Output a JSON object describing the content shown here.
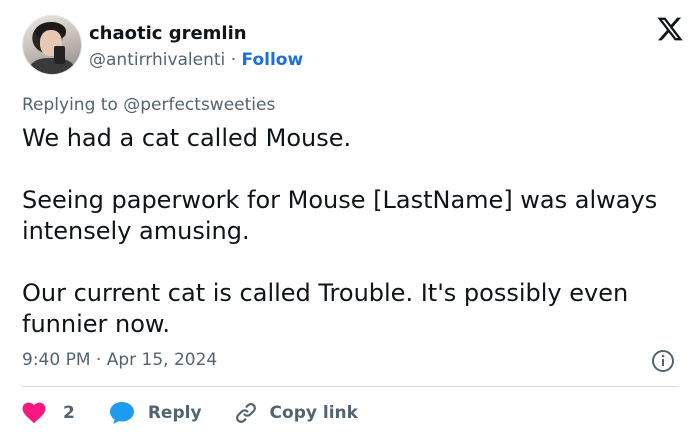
{
  "author": {
    "display_name": "chaotic gremlin",
    "handle": "@antirrhivalenti",
    "separator": "·",
    "follow_label": "Follow"
  },
  "platform_icon": "x-logo-icon",
  "reply_context": {
    "prefix": "Replying to",
    "mention": "@perfectsweeties"
  },
  "tweet": {
    "paragraphs": [
      "We had a cat called Mouse.",
      "Seeing paperwork for Mouse [LastName] was always intensely amusing.",
      "Our current cat is called Trouble. It's possibly even funnier now."
    ]
  },
  "timestamp": "9:40 PM · Apr 15, 2024",
  "info_icon": "info-circle-icon",
  "actions": {
    "like": {
      "icon": "heart-icon",
      "count": "2",
      "color": "#f91880"
    },
    "reply": {
      "icon": "speech-bubble-icon",
      "label": "Reply",
      "color": "#1d9bf0"
    },
    "copy": {
      "icon": "link-icon",
      "label": "Copy link"
    }
  },
  "colors": {
    "text": "#0f1419",
    "muted": "#536471",
    "link": "#1d6fd9",
    "divider": "#cfd9de"
  }
}
